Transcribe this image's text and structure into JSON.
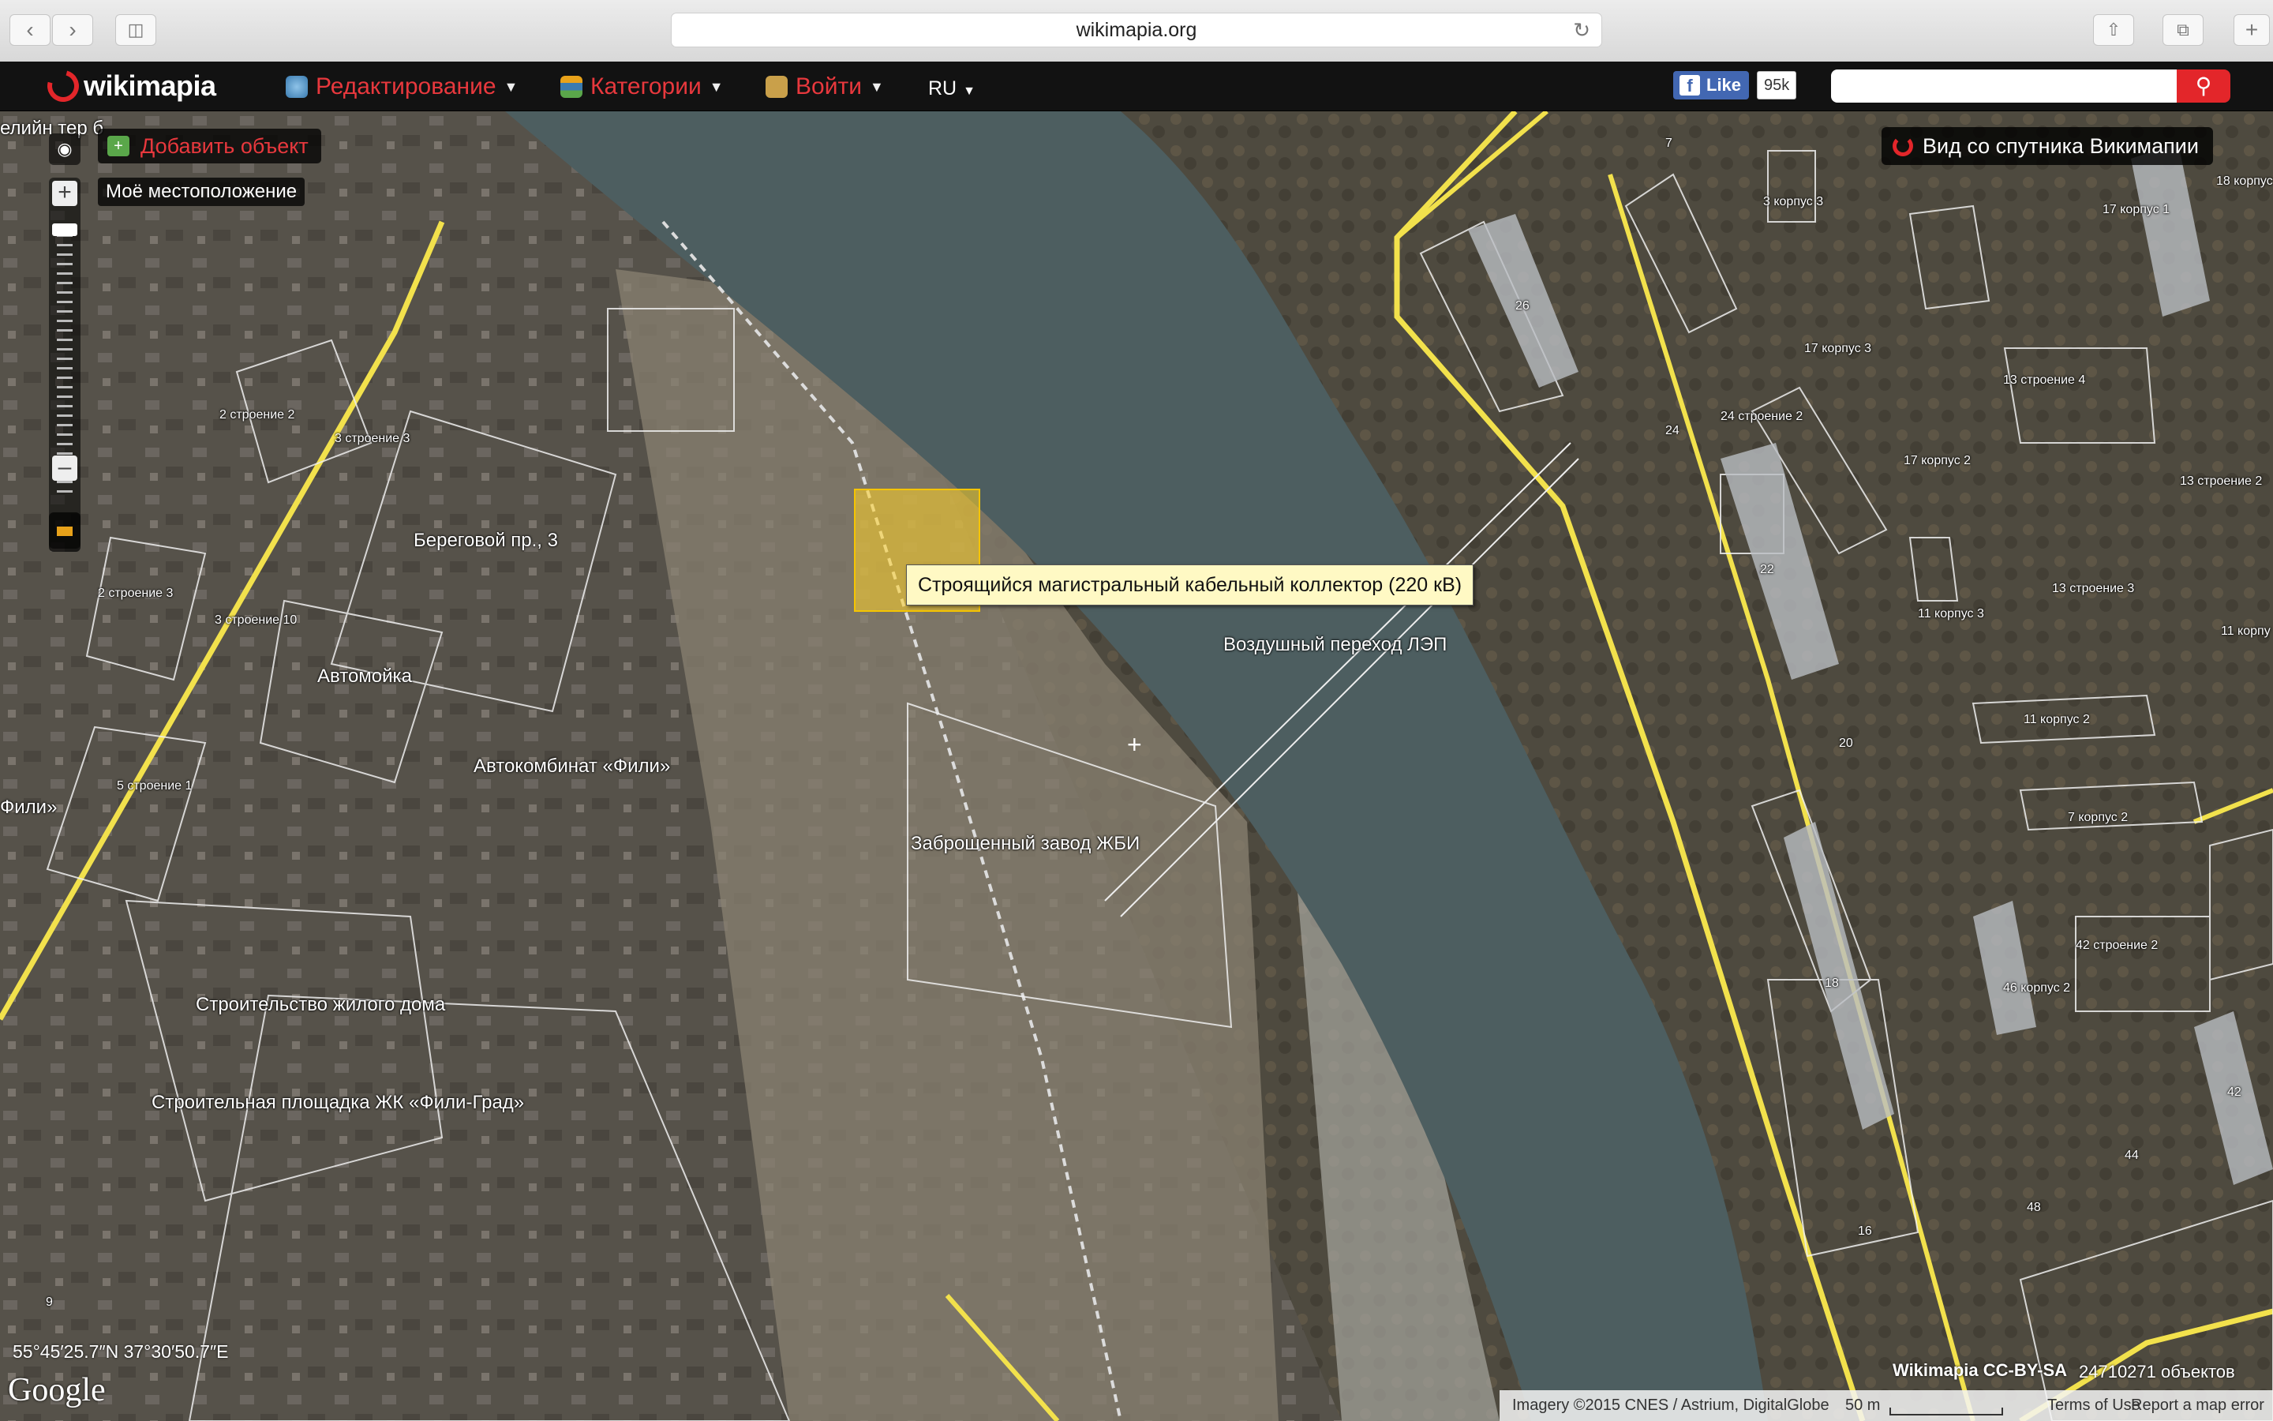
{
  "browser": {
    "url": "wikimapia.org"
  },
  "header": {
    "logo_text": "wikimapia",
    "menu": [
      {
        "label": "Редактирование"
      },
      {
        "label": "Категории"
      },
      {
        "label": "Войти"
      }
    ],
    "language": "RU",
    "facebook": {
      "like_label": "Like",
      "count": "95k"
    },
    "search": {
      "placeholder": ""
    }
  },
  "map_controls": {
    "add_object": "Добавить объект",
    "my_location": "Моё местоположение",
    "satellite_view": "Вид со спутника Викимапии"
  },
  "tooltip": "Строящийся магистральный кабельный коллектор (220 кВ)",
  "labels": {
    "l1": "елийн тер б",
    "l2": "2 строение 2",
    "l3": "3 строение 3",
    "l4": "Береговой пр., 3",
    "l5": "2 строение 3",
    "l6": "3 строение 10",
    "l7": "Автомойка",
    "l8": "Автокомбинат «Фили»",
    "l9": "5 строение 1",
    "l10": "Фили»",
    "l11": "Строительство жилого дома",
    "l12": "Строительная площадка ЖК «Фили-Град»",
    "l13": "Воздушный переход ЛЭП",
    "l14": "Заброшенный завод ЖБИ",
    "l15": "7",
    "l16": "3 корпус 3",
    "l17": "17 корпус 1",
    "l18": "18 корпус",
    "l19": "26",
    "l20": "17 корпус 3",
    "l21": "13 строение 4",
    "l22": "24",
    "l23": "24 строение 2",
    "l24": "17 корпус 2",
    "l25": "13 строение 2",
    "l26": "22",
    "l27": "13 строение 3",
    "l28": "11 корпус 3",
    "l29": "11 корпу",
    "l30": "20",
    "l31": "11 корпус 2",
    "l32": "7 корпус 2",
    "l33": "42 строение 2",
    "l34": "18",
    "l35": "46 корпус 2",
    "l36": "42",
    "l37": "44",
    "l38": "48",
    "l39": "16",
    "l40": "9"
  },
  "footer": {
    "coordinates": "55°45′25.7″N 37°30′50.7″E",
    "google": "Google",
    "license": "Wikimapia CC-BY-SA",
    "objects_count": "24710271 объектов",
    "imagery": "Imagery ©2015 CNES / Astrium, DigitalGlobe",
    "scale": "50 m",
    "terms": "Terms of Use",
    "report": "Report a map error"
  },
  "colors": {
    "brand_red": "#e3262a",
    "road_yellow": "#f2e14c",
    "river": "#4d5e60",
    "tooltip_bg": "#fff9c4"
  }
}
